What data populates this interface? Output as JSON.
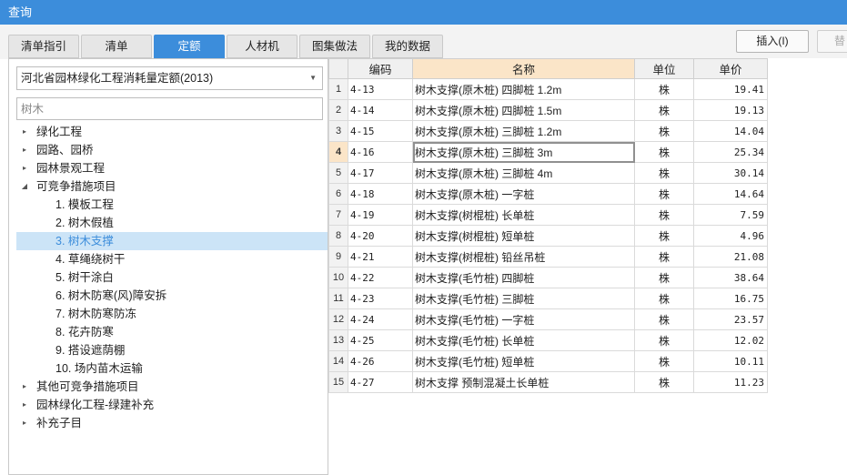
{
  "window": {
    "title": "查询"
  },
  "tabs": [
    {
      "label": "清单指引",
      "active": false
    },
    {
      "label": "清单",
      "active": false
    },
    {
      "label": "定额",
      "active": true
    },
    {
      "label": "人材机",
      "active": false
    },
    {
      "label": "图集做法",
      "active": false
    },
    {
      "label": "我的数据",
      "active": false
    }
  ],
  "toolbar": {
    "insert_label": "插入(I)",
    "replace_label": "替"
  },
  "left": {
    "quota_library": "河北省园林绿化工程消耗量定额(2013)",
    "search": {
      "value": "",
      "placeholder": "树木"
    },
    "tree": [
      {
        "label": "绿化工程",
        "level": 0,
        "toggle": "▸",
        "selected": false
      },
      {
        "label": "园路、园桥",
        "level": 0,
        "toggle": "▸",
        "selected": false
      },
      {
        "label": "园林景观工程",
        "level": 0,
        "toggle": "▸",
        "selected": false
      },
      {
        "label": "可竞争措施项目",
        "level": 0,
        "toggle": "◢",
        "selected": false
      },
      {
        "label": "1. 模板工程",
        "level": 1,
        "toggle": "",
        "selected": false
      },
      {
        "label": "2. 树木假植",
        "level": 1,
        "toggle": "",
        "selected": false
      },
      {
        "label": "3. 树木支撑",
        "level": 1,
        "toggle": "",
        "selected": true
      },
      {
        "label": "4. 草绳绕树干",
        "level": 1,
        "toggle": "",
        "selected": false
      },
      {
        "label": "5. 树干涂白",
        "level": 1,
        "toggle": "",
        "selected": false
      },
      {
        "label": "6. 树木防寒(风)障安拆",
        "level": 1,
        "toggle": "",
        "selected": false
      },
      {
        "label": "7. 树木防寒防冻",
        "level": 1,
        "toggle": "",
        "selected": false
      },
      {
        "label": "8. 花卉防寒",
        "level": 1,
        "toggle": "",
        "selected": false
      },
      {
        "label": "9. 搭设遮荫棚",
        "level": 1,
        "toggle": "",
        "selected": false
      },
      {
        "label": "10. 场内苗木运输",
        "level": 1,
        "toggle": "",
        "selected": false
      },
      {
        "label": "其他可竞争措施项目",
        "level": 0,
        "toggle": "▸",
        "selected": false
      },
      {
        "label": "园林绿化工程-绿建补充",
        "level": 0,
        "toggle": "▸",
        "selected": false
      },
      {
        "label": "补充子目",
        "level": 0,
        "toggle": "▸",
        "selected": false
      }
    ]
  },
  "table": {
    "columns": [
      "编码",
      "名称",
      "单位",
      "单价"
    ],
    "current_row": 4,
    "rows": [
      {
        "n": "1",
        "code": "4-13",
        "name": "树木支撑(原木桩) 四脚桩 1.2m",
        "unit": "株",
        "price": "19.41"
      },
      {
        "n": "2",
        "code": "4-14",
        "name": "树木支撑(原木桩) 四脚桩 1.5m",
        "unit": "株",
        "price": "19.13"
      },
      {
        "n": "3",
        "code": "4-15",
        "name": "树木支撑(原木桩) 三脚桩 1.2m",
        "unit": "株",
        "price": "14.04"
      },
      {
        "n": "4",
        "code": "4-16",
        "name": "树木支撑(原木桩) 三脚桩 3m",
        "unit": "株",
        "price": "25.34"
      },
      {
        "n": "5",
        "code": "4-17",
        "name": "树木支撑(原木桩) 三脚桩 4m",
        "unit": "株",
        "price": "30.14"
      },
      {
        "n": "6",
        "code": "4-18",
        "name": "树木支撑(原木桩) 一字桩",
        "unit": "株",
        "price": "14.64"
      },
      {
        "n": "7",
        "code": "4-19",
        "name": "树木支撑(树棍桩) 长单桩",
        "unit": "株",
        "price": "7.59"
      },
      {
        "n": "8",
        "code": "4-20",
        "name": "树木支撑(树棍桩) 短单桩",
        "unit": "株",
        "price": "4.96"
      },
      {
        "n": "9",
        "code": "4-21",
        "name": "树木支撑(树棍桩) 铅丝吊桩",
        "unit": "株",
        "price": "21.08"
      },
      {
        "n": "10",
        "code": "4-22",
        "name": "树木支撑(毛竹桩) 四脚桩",
        "unit": "株",
        "price": "38.64"
      },
      {
        "n": "11",
        "code": "4-23",
        "name": "树木支撑(毛竹桩) 三脚桩",
        "unit": "株",
        "price": "16.75"
      },
      {
        "n": "12",
        "code": "4-24",
        "name": "树木支撑(毛竹桩) 一字桩",
        "unit": "株",
        "price": "23.57"
      },
      {
        "n": "13",
        "code": "4-25",
        "name": "树木支撑(毛竹桩) 长单桩",
        "unit": "株",
        "price": "12.02"
      },
      {
        "n": "14",
        "code": "4-26",
        "name": "树木支撑(毛竹桩) 短单桩",
        "unit": "株",
        "price": "10.11"
      },
      {
        "n": "15",
        "code": "4-27",
        "name": "树木支撑 预制混凝土长单桩",
        "unit": "株",
        "price": "11.23"
      }
    ]
  }
}
